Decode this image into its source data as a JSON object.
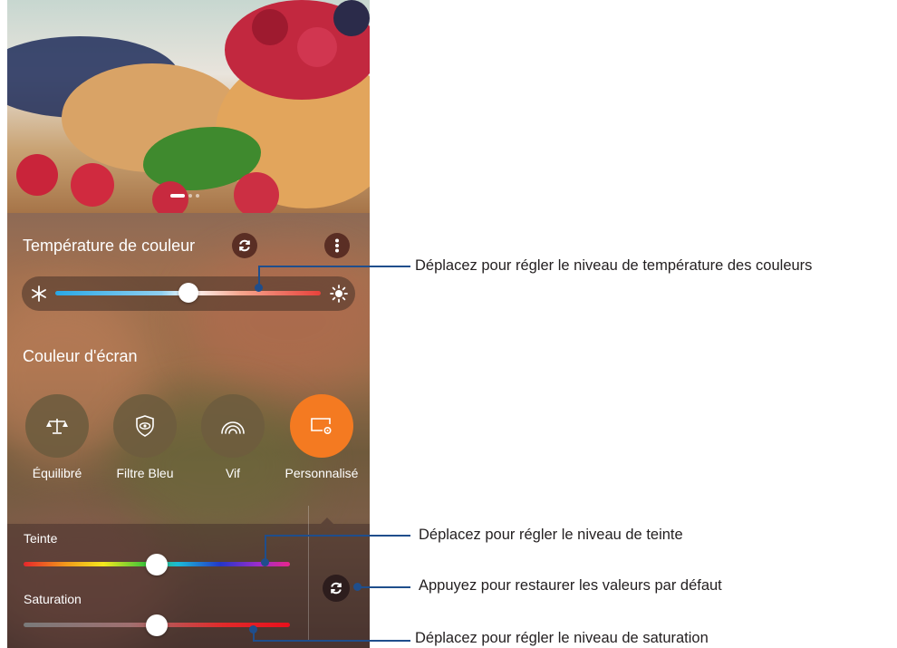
{
  "colors": {
    "accent_orange": "#f47a21",
    "annotation_blue": "#1f4e8c",
    "annotation_text": "#231f20"
  },
  "panel": {
    "color_temperature": {
      "title": "Température de couleur",
      "reset_icon": "refresh-icon",
      "menu_icon": "more-vertical-icon",
      "left_icon": "snowflake-icon",
      "right_icon": "sun-icon",
      "value_fraction": 0.5
    },
    "screen_color": {
      "title": "Couleur d'écran",
      "modes": [
        {
          "label": "Équilibré",
          "icon": "balance-scale-icon",
          "active": false
        },
        {
          "label": "Filtre Bleu",
          "icon": "eye-shield-icon",
          "active": false
        },
        {
          "label": "Vif",
          "icon": "vivid-arcs-icon",
          "active": false
        },
        {
          "label": "Personnalisé",
          "icon": "custom-screen-icon",
          "active": true
        }
      ]
    },
    "custom": {
      "hue_label": "Teinte",
      "hue_fraction": 0.5,
      "saturation_label": "Saturation",
      "saturation_fraction": 0.5,
      "reset_icon": "refresh-icon"
    }
  },
  "annotations": {
    "temperature": "Déplacez pour régler le niveau de température des couleurs",
    "hue": "Déplacez pour régler le niveau de teinte",
    "reset": "Appuyez pour restaurer les valeurs par défaut",
    "saturation": "Déplacez pour régler le niveau de saturation"
  }
}
